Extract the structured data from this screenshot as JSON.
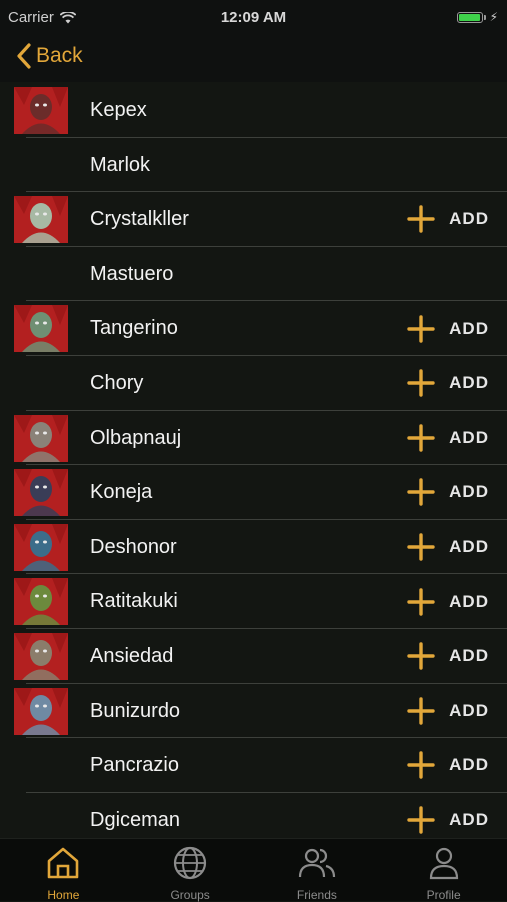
{
  "status_bar": {
    "carrier": "Carrier",
    "time": "12:09 AM"
  },
  "nav": {
    "back_label": "Back"
  },
  "list": {
    "add_label": "ADD",
    "rows": [
      {
        "name": "Kepex",
        "avatar": true,
        "add": false,
        "avatar_tint": "#6b2c2a"
      },
      {
        "name": "Marlok",
        "avatar": false,
        "add": false
      },
      {
        "name": "Crystalkller",
        "avatar": true,
        "add": true,
        "avatar_tint": "#a7b9a4"
      },
      {
        "name": "Mastuero",
        "avatar": false,
        "add": false
      },
      {
        "name": "Tangerino",
        "avatar": true,
        "add": true,
        "avatar_tint": "#6f8f73"
      },
      {
        "name": "Chory",
        "avatar": false,
        "add": true
      },
      {
        "name": "Olbapnauj",
        "avatar": true,
        "add": true,
        "avatar_tint": "#8a8278"
      },
      {
        "name": "Koneja",
        "avatar": true,
        "add": true,
        "avatar_tint": "#3a3d57"
      },
      {
        "name": "Deshonor",
        "avatar": true,
        "add": true,
        "avatar_tint": "#3c6d8a"
      },
      {
        "name": "Ratitakuki",
        "avatar": true,
        "add": true,
        "avatar_tint": "#6c8a3d"
      },
      {
        "name": "Ansiedad",
        "avatar": true,
        "add": true,
        "avatar_tint": "#8b7d6b"
      },
      {
        "name": "Bunizurdo",
        "avatar": true,
        "add": true,
        "avatar_tint": "#6f8aa3"
      },
      {
        "name": "Pancrazio",
        "avatar": false,
        "add": true
      },
      {
        "name": "Dgiceman",
        "avatar": false,
        "add": true
      }
    ]
  },
  "tabs": [
    {
      "label": "Home",
      "icon": "home-icon",
      "active": true
    },
    {
      "label": "Groups",
      "icon": "globe-icon",
      "active": false
    },
    {
      "label": "Friends",
      "icon": "friends-icon",
      "active": false
    },
    {
      "label": "Profile",
      "icon": "profile-icon",
      "active": false
    }
  ],
  "colors": {
    "accent": "#e2a73a",
    "background": "#131612",
    "avatar_bg": "#b32020"
  }
}
